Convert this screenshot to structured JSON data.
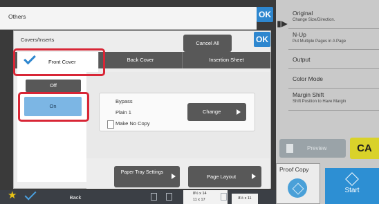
{
  "others": {
    "title": "Others",
    "ok_label": "OK"
  },
  "dialog": {
    "title": "Covers/Inserts",
    "cancel_all": "Cancel All",
    "ok_label": "OK",
    "tabs": [
      {
        "label": "Front Cover",
        "selected": true
      },
      {
        "label": "Back Cover"
      },
      {
        "label": "Insertion Sheet"
      }
    ],
    "off_label": "Off",
    "on_label": "On",
    "paper": {
      "tray": "Bypass",
      "type": "Plain 1",
      "make_no_copy": "Make No Copy"
    },
    "change_label": "Change",
    "paper_tray_settings": "Paper Tray Settings",
    "page_layout": "Page Layout"
  },
  "side_panel": {
    "items": [
      {
        "title": "Original",
        "subtitle": "Change Size/Direction."
      },
      {
        "title": "N-Up",
        "subtitle": "Put Multiple Pages in A Page"
      },
      {
        "title": "Output"
      },
      {
        "title": "Color Mode"
      },
      {
        "title": "Margin Shift",
        "subtitle": "Shift Position to Have Margin"
      }
    ],
    "preview_label": "Preview",
    "ca_label": "CA",
    "proof_copy_label": "Proof Copy",
    "start_label": "Start"
  },
  "bottom_bar": {
    "back_label": "Back",
    "paper_sizes": [
      "8½ x 14",
      "11 x 17",
      "8½ x 11"
    ]
  },
  "colors": {
    "highlight": "#d82636",
    "accent": "#2e87cf",
    "ca": "#d9d22a",
    "start": "#2d8fd3"
  }
}
